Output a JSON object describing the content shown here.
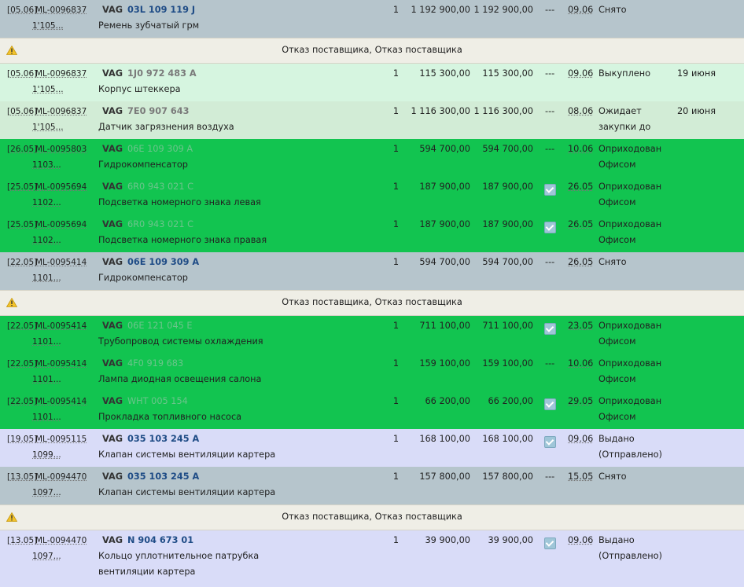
{
  "colors": {
    "gray_row": "#b6c5cc",
    "light_green_row": "#d6f5e0",
    "pale_green_row": "#d2ecd6",
    "green_row": "#12c450",
    "lavender_row": "#d9dcf8",
    "separator": "#efeee6",
    "warning": "#f2c22b"
  },
  "separator_text": "Отказ поставщика, Отказ поставщика",
  "rows": [
    {
      "date": "[05.06]",
      "order": "ML-0096837",
      "sub": "1'105...",
      "brand": "VAG",
      "code": "03L 109 119 J",
      "name": "Ремень зубчатый грм",
      "name2": "",
      "qty": "1",
      "price": "1 192 900,00",
      "total": "1 192 900,00",
      "mark": "---",
      "ddate": "09.06",
      "status": "Снято",
      "status2": "",
      "extra": ""
    },
    {
      "date": "[05.06]",
      "order": "ML-0096837",
      "sub": "1'105...",
      "brand": "VAG",
      "code": "1J0 972 483 A",
      "name": "Корпус штеккера",
      "name2": "",
      "qty": "1",
      "price": "115 300,00",
      "total": "115 300,00",
      "mark": "---",
      "ddate": "09.06",
      "status": "Выкуплено",
      "status2": "",
      "extra": "19 июня"
    },
    {
      "date": "[05.06]",
      "order": "ML-0096837",
      "sub": "1'105...",
      "brand": "VAG",
      "code": "7E0 907 643",
      "name": "Датчик загрязнения воздуха",
      "name2": "",
      "qty": "1",
      "price": "1 116 300,00",
      "total": "1 116 300,00",
      "mark": "---",
      "ddate": "08.06",
      "status": "Ожидает",
      "status2": "закупки до",
      "extra": "20 июня"
    },
    {
      "date": "[26.05]",
      "order": "ML-0095803",
      "sub": "1103...",
      "brand": "VAG",
      "code": "06E 109 309 A",
      "name": "Гидрокомпенсатор",
      "name2": "",
      "qty": "1",
      "price": "594 700,00",
      "total": "594 700,00",
      "mark": "---",
      "ddate": "10.06",
      "status": "Оприходован",
      "status2": "Офисом",
      "extra": ""
    },
    {
      "date": "[25.05]",
      "order": "ML-0095694",
      "sub": "1102...",
      "brand": "VAG",
      "code": "6R0 943 021 C",
      "name": "Подсветка номерного знака левая",
      "name2": "",
      "qty": "1",
      "price": "187 900,00",
      "total": "187 900,00",
      "mark": "",
      "ddate": "26.05",
      "status": "Оприходован",
      "status2": "Офисом",
      "extra": ""
    },
    {
      "date": "[25.05]",
      "order": "ML-0095694",
      "sub": "1102...",
      "brand": "VAG",
      "code": "6R0 943 021 C",
      "name": "Подсветка номерного знака правая",
      "name2": "",
      "qty": "1",
      "price": "187 900,00",
      "total": "187 900,00",
      "mark": "",
      "ddate": "26.05",
      "status": "Оприходован",
      "status2": "Офисом",
      "extra": ""
    },
    {
      "date": "[22.05]",
      "order": "ML-0095414",
      "sub": "1101...",
      "brand": "VAG",
      "code": "06E 109 309 A",
      "name": "Гидрокомпенсатор",
      "name2": "",
      "qty": "1",
      "price": "594 700,00",
      "total": "594 700,00",
      "mark": "---",
      "ddate": "26.05",
      "status": "Снято",
      "status2": "",
      "extra": ""
    },
    {
      "date": "[22.05]",
      "order": "ML-0095414",
      "sub": "1101...",
      "brand": "VAG",
      "code": "06E 121 045 E",
      "name": "Трубопровод системы охлаждения",
      "name2": "",
      "qty": "1",
      "price": "711 100,00",
      "total": "711 100,00",
      "mark": "",
      "ddate": "23.05",
      "status": "Оприходован",
      "status2": "Офисом",
      "extra": ""
    },
    {
      "date": "[22.05]",
      "order": "ML-0095414",
      "sub": "1101...",
      "brand": "VAG",
      "code": "4F0 919 683",
      "name": "Лампа диодная освещения салона",
      "name2": "",
      "qty": "1",
      "price": "159 100,00",
      "total": "159 100,00",
      "mark": "---",
      "ddate": "10.06",
      "status": "Оприходован",
      "status2": "Офисом",
      "extra": ""
    },
    {
      "date": "[22.05]",
      "order": "ML-0095414",
      "sub": "1101...",
      "brand": "VAG",
      "code": "WHT 005 154",
      "name": "Прокладка топливного насоса",
      "name2": "",
      "qty": "1",
      "price": "66 200,00",
      "total": "66 200,00",
      "mark": "",
      "ddate": "29.05",
      "status": "Оприходован",
      "status2": "Офисом",
      "extra": ""
    },
    {
      "date": "[19.05]",
      "order": "ML-0095115",
      "sub": "1099...",
      "brand": "VAG",
      "code": "035 103 245 A",
      "name": "Клапан системы вентиляции картера",
      "name2": "",
      "qty": "1",
      "price": "168 100,00",
      "total": "168 100,00",
      "mark": "",
      "ddate": "09.06",
      "status": "Выдано",
      "status2": "(Отправлено)",
      "extra": ""
    },
    {
      "date": "[13.05]",
      "order": "ML-0094470",
      "sub": "1097...",
      "brand": "VAG",
      "code": "035 103 245 A",
      "name": "Клапан системы вентиляции картера",
      "name2": "",
      "qty": "1",
      "price": "157 800,00",
      "total": "157 800,00",
      "mark": "---",
      "ddate": "15.05",
      "status": "Снято",
      "status2": "",
      "extra": ""
    },
    {
      "date": "[13.05]",
      "order": "ML-0094470",
      "sub": "1097...",
      "brand": "VAG",
      "code": "N 904 673 01",
      "name": "Кольцо уплотнительное патрубка",
      "name2": "вентиляции картера",
      "qty": "1",
      "price": "39 900,00",
      "total": "39 900,00",
      "mark": "",
      "ddate": "09.06",
      "status": "Выдано",
      "status2": "(Отправлено)",
      "extra": ""
    }
  ]
}
